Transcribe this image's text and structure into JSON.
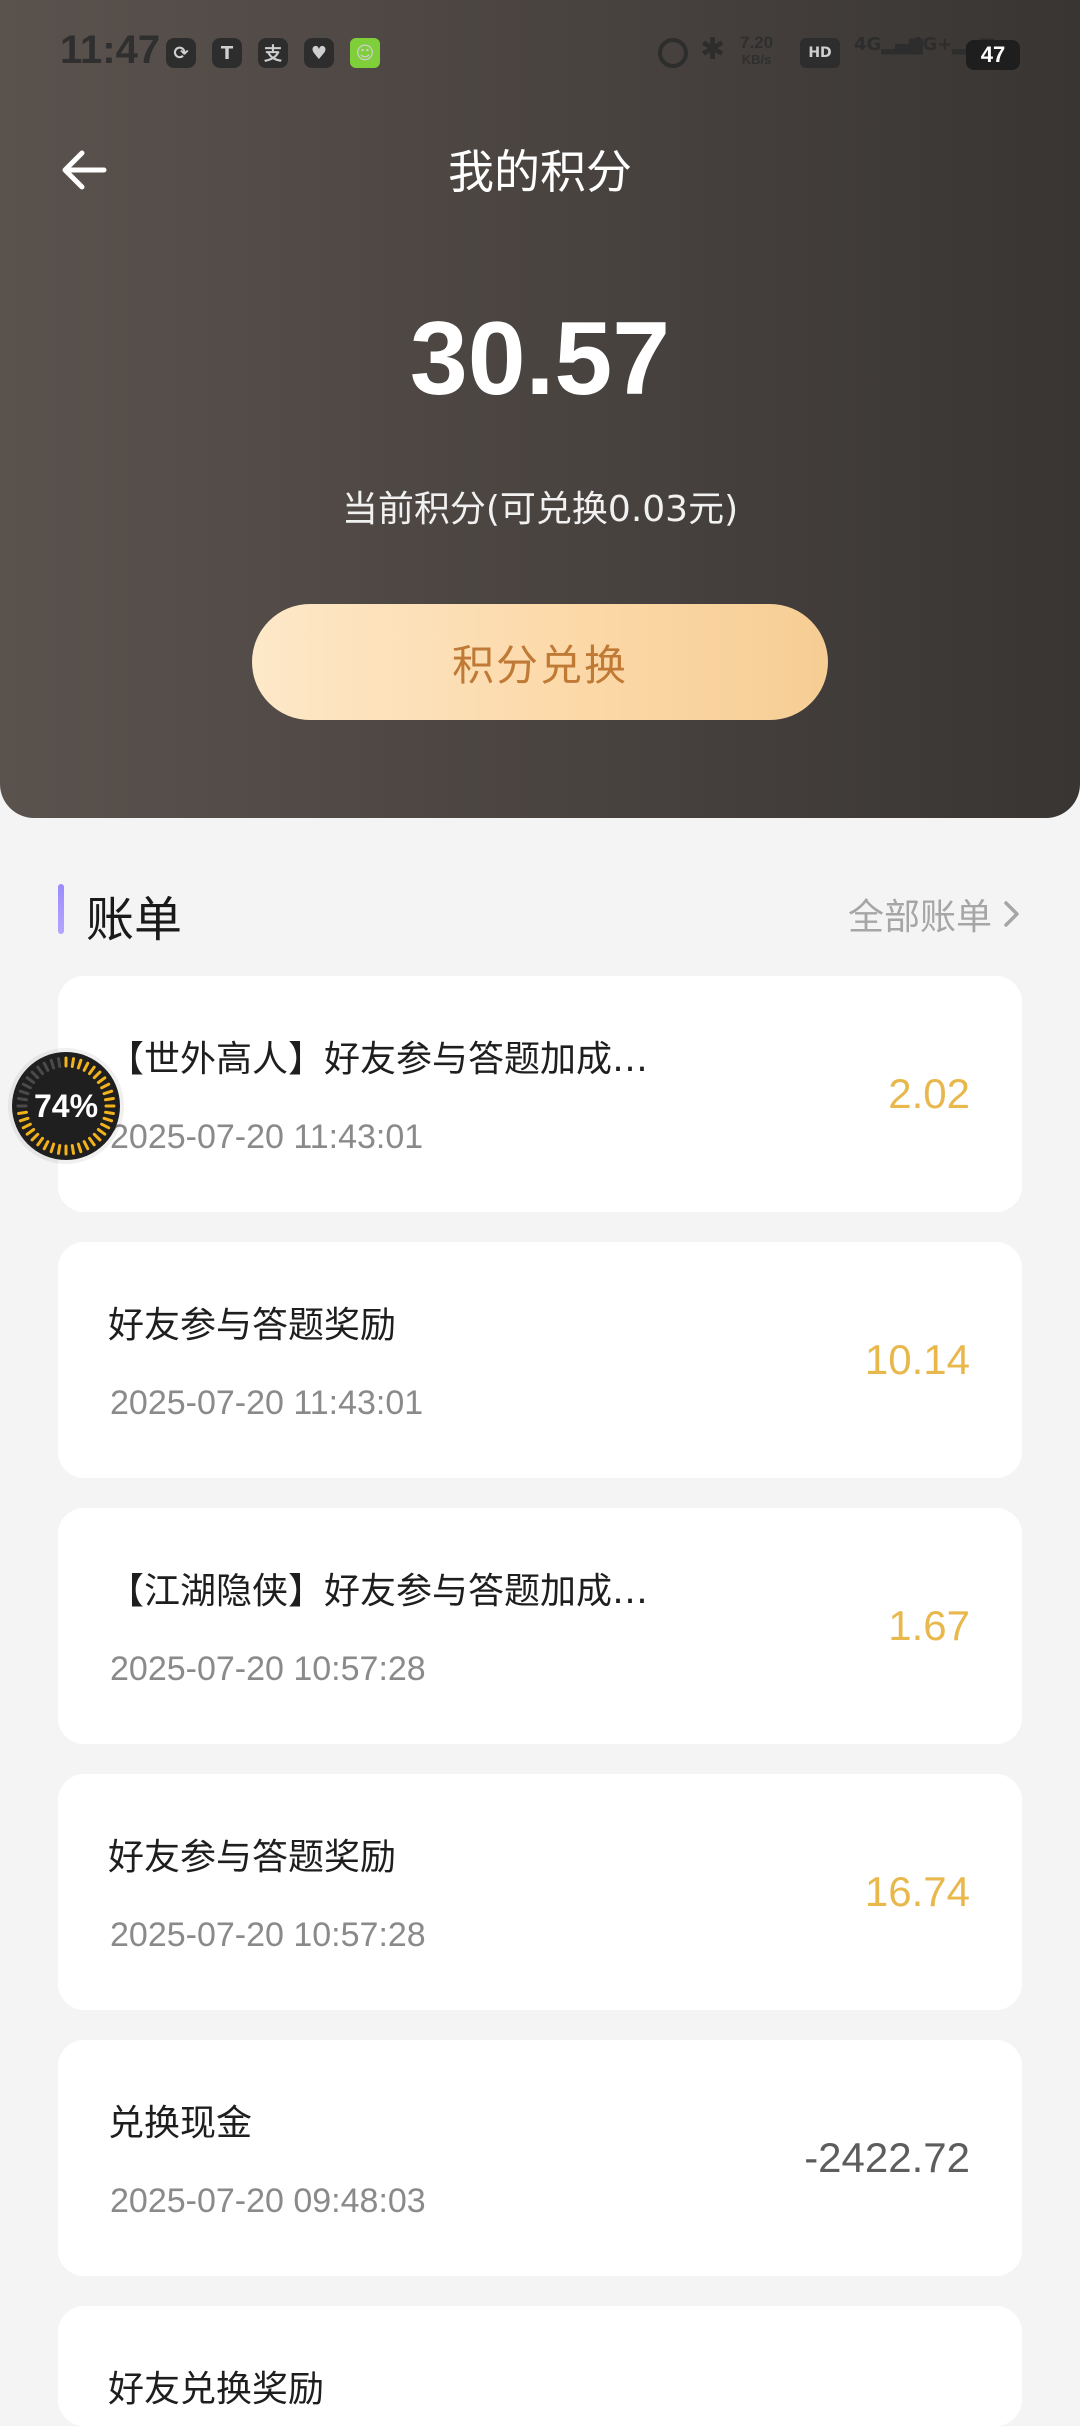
{
  "status_bar": {
    "time": "11:47",
    "net_speed": "7.20",
    "net_speed_unit": "KB/s",
    "battery": "47"
  },
  "header": {
    "title": "我的积分",
    "points": "30.57",
    "points_subtitle": "当前积分(可兑换0.03元)",
    "exchange_button": "积分兑换"
  },
  "bill": {
    "title": "账单",
    "all_link": "全部账单",
    "items": [
      {
        "title": "【世外高人】好友参与答题加成…",
        "date": "2025-07-20 11:43:01",
        "amount": "2.02"
      },
      {
        "title": "好友参与答题奖励",
        "date": "2025-07-20 11:43:01",
        "amount": "10.14"
      },
      {
        "title": "【江湖隐侠】好友参与答题加成…",
        "date": "2025-07-20 10:57:28",
        "amount": "1.67"
      },
      {
        "title": "好友参与答题奖励",
        "date": "2025-07-20 10:57:28",
        "amount": "16.74"
      },
      {
        "title": "兑换现金",
        "date": "2025-07-20 09:48:03",
        "amount": "-2422.72"
      },
      {
        "title": "好友兑换奖励",
        "date": "",
        "amount": ""
      }
    ]
  },
  "floating_badge": {
    "percent": "74%",
    "progress": 0.74
  },
  "colors": {
    "accent_gold": "#e8b84c",
    "button_text": "#c07a36",
    "header_dark": "#4a4441"
  }
}
